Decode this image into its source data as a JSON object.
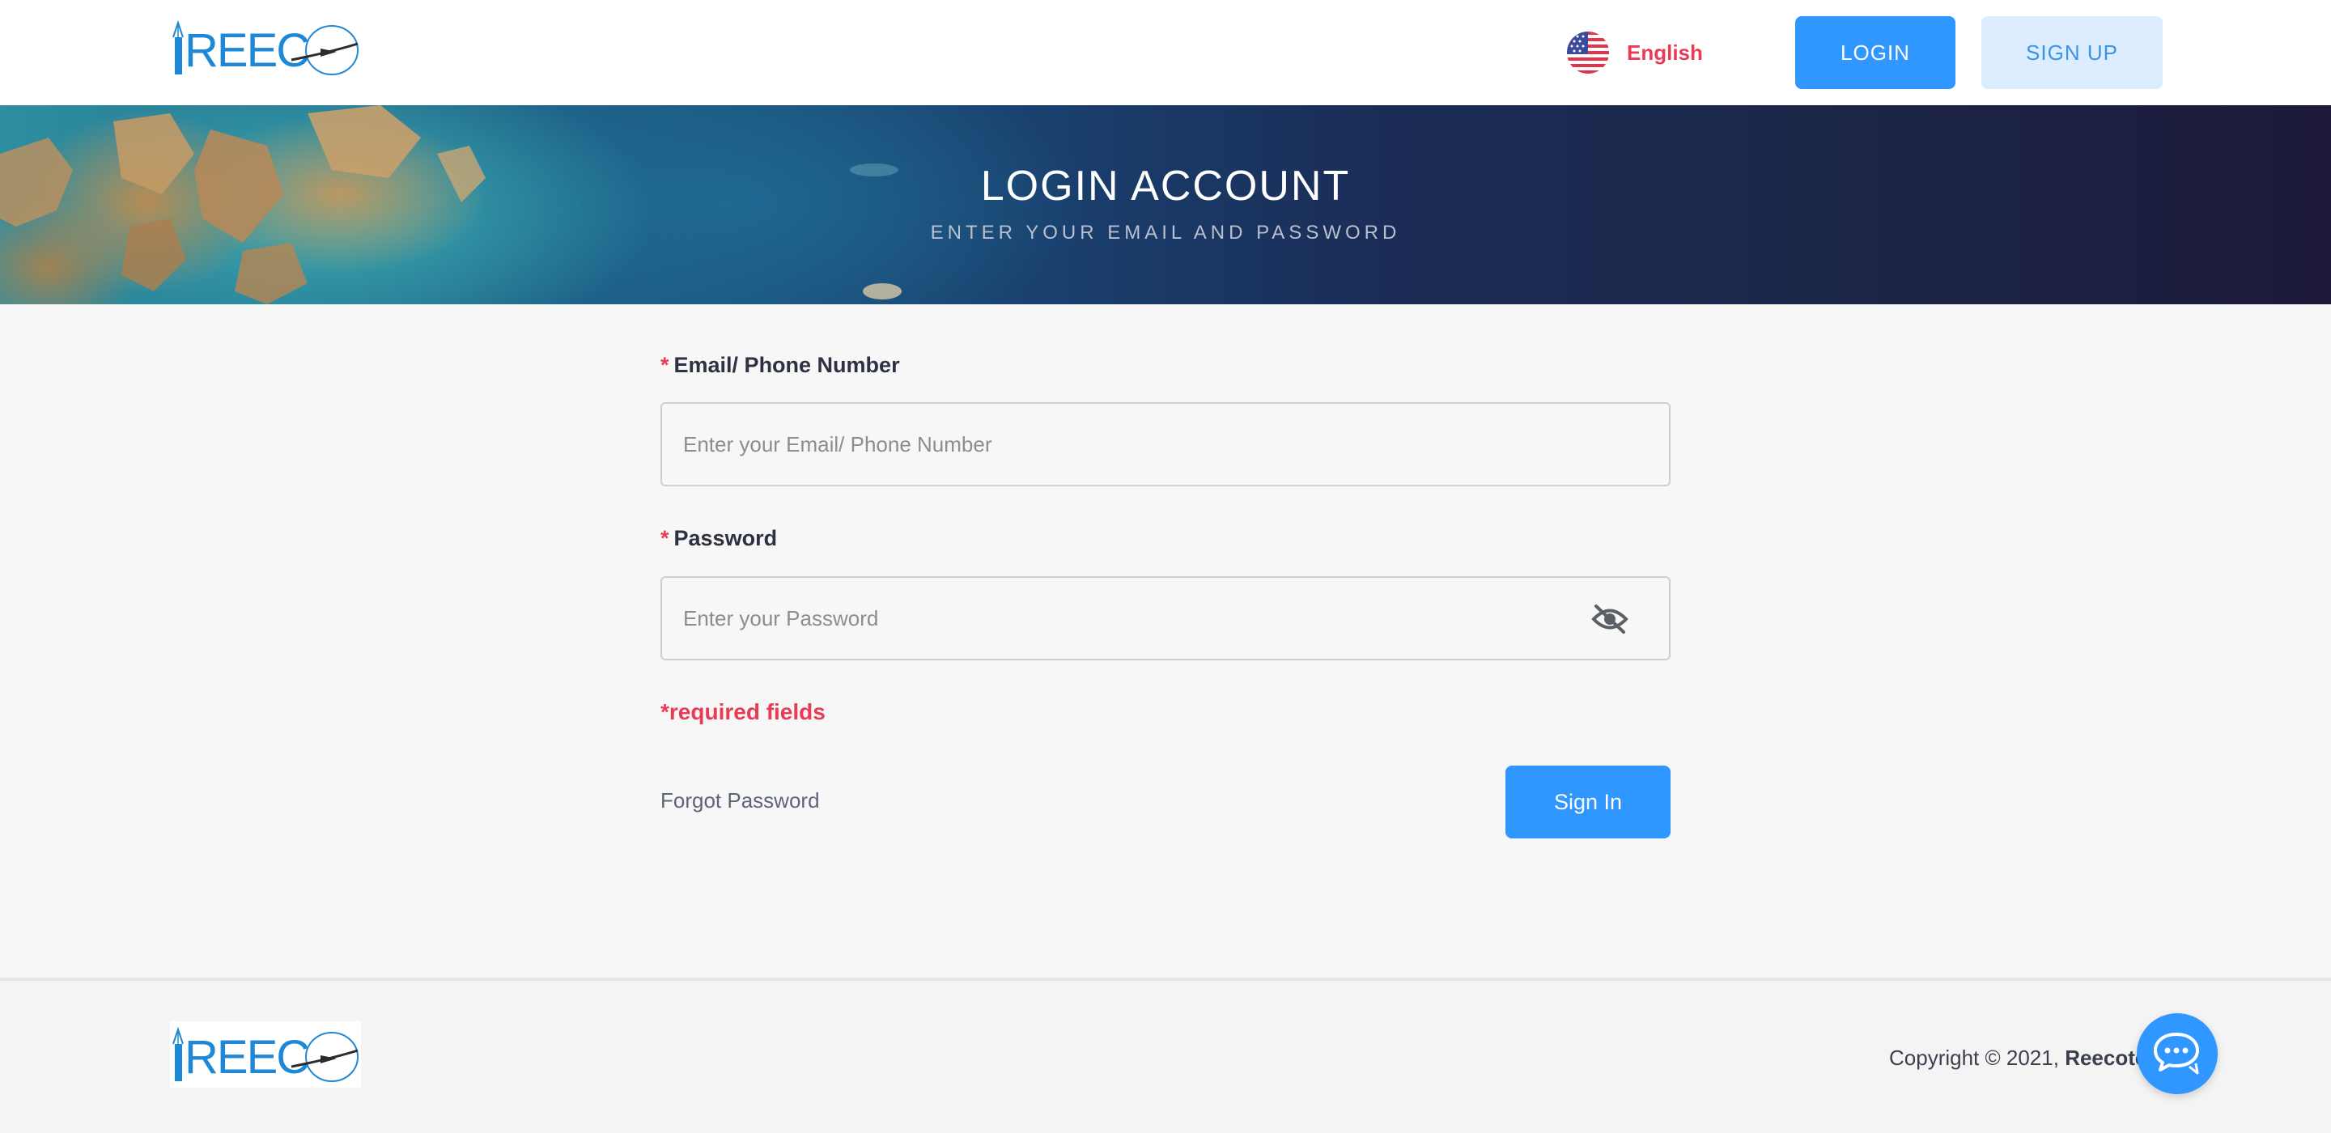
{
  "header": {
    "logo_text": "REECO",
    "language": {
      "label": "English",
      "icon": "us-flag-icon"
    },
    "login_label": "LOGIN",
    "signup_label": "SIGN UP"
  },
  "banner": {
    "title": "LOGIN ACCOUNT",
    "subtitle": "ENTER YOUR EMAIL AND PASSWORD"
  },
  "form": {
    "email": {
      "required_mark": "*",
      "label": "Email/ Phone Number",
      "placeholder": "Enter your Email/ Phone Number",
      "value": ""
    },
    "password": {
      "required_mark": "*",
      "label": "Password",
      "placeholder": "Enter your Password",
      "value": "",
      "toggle_icon": "eye-off-icon"
    },
    "required_note": "*required fields",
    "forgot_label": "Forgot Password",
    "signin_label": "Sign In"
  },
  "footer": {
    "logo_text": "REECO",
    "copyright_prefix": "Copyright © 2021,",
    "company": "Reecote",
    "chat_icon": "chat-bubbles-icon"
  },
  "colors": {
    "primary": "#2f97ff",
    "accent_red": "#ea3b55",
    "signup_bg": "#dcedff",
    "page_bg": "#f7f7f7"
  }
}
